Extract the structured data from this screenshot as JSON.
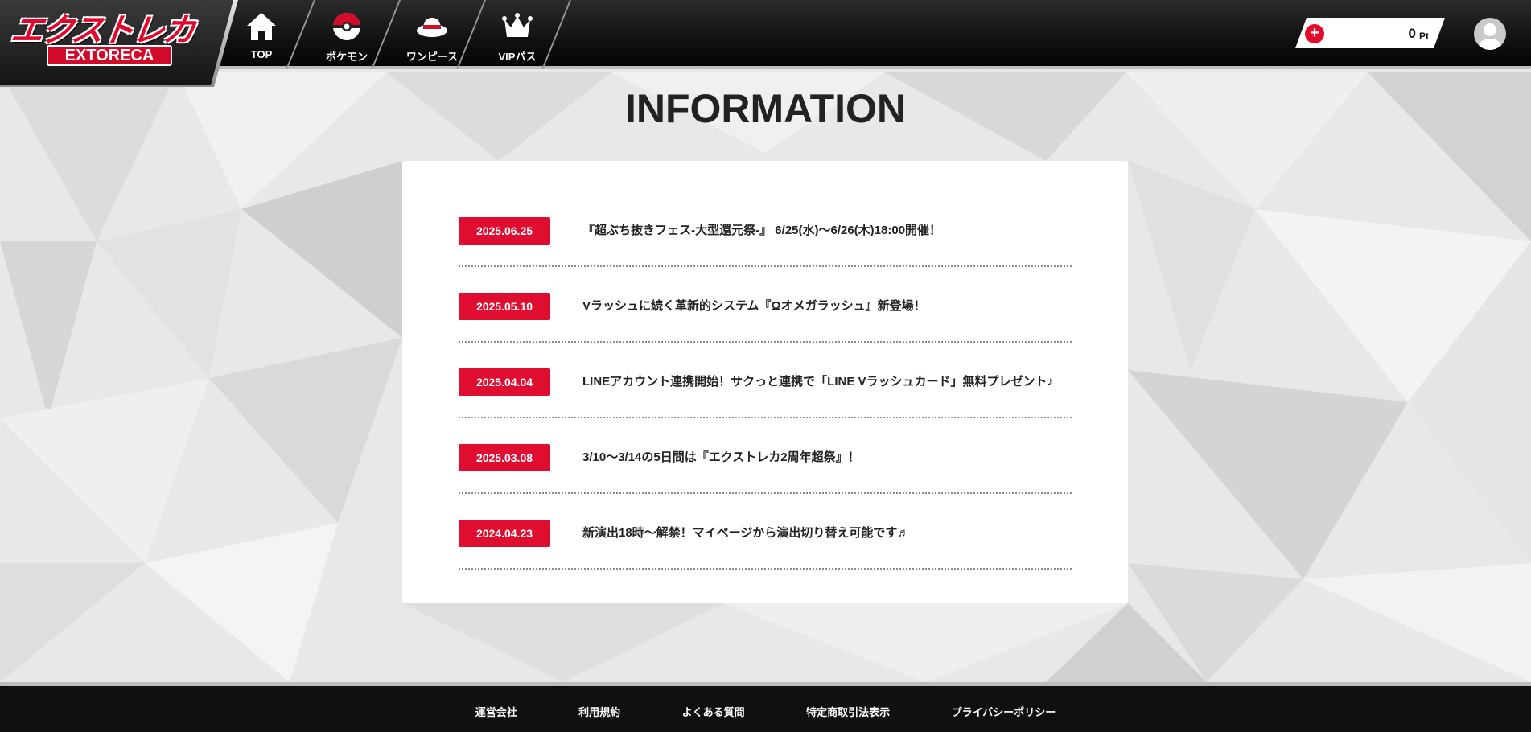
{
  "header": {
    "logo_jp": "エクストレカ",
    "logo_en": "EXTORECA",
    "nav": [
      {
        "label": "TOP",
        "icon": "home-icon"
      },
      {
        "label": "ポケモン",
        "icon": "pokeball-icon"
      },
      {
        "label": "ワンピース",
        "icon": "straw-hat-icon"
      },
      {
        "label": "VIPパス",
        "icon": "crown-icon"
      }
    ],
    "points": {
      "add_icon": "plus-icon",
      "add_symbol": "+",
      "value": "0",
      "unit": "Pt"
    },
    "avatar_icon": "user-avatar-icon"
  },
  "main": {
    "title": "INFORMATION",
    "news": [
      {
        "date": "2025.06.25",
        "title": "『超ぶち抜きフェス-大型還元祭-』 6/25(水)〜6/26(木)18:00開催！"
      },
      {
        "date": "2025.05.10",
        "title": "Vラッシュに続く革新的システム『Ωオメガラッシュ』新登場！"
      },
      {
        "date": "2025.04.04",
        "title": "LINEアカウント連携開始！サクっと連携で「LINE Vラッシュカード」無料プレゼント♪"
      },
      {
        "date": "2025.03.08",
        "title": "3/10〜3/14の5日間は『エクストレカ2周年超祭』！"
      },
      {
        "date": "2024.04.23",
        "title": "新演出18時〜解禁！マイページから演出切り替え可能です♬"
      }
    ]
  },
  "footer": {
    "links": [
      "運営会社",
      "利用規約",
      "よくある質問",
      "特定商取引法表示",
      "プライバシーポリシー"
    ]
  },
  "colors": {
    "accent_red": "#df0d30",
    "header_black": "#111111",
    "page_bg": "#e9e9e9"
  }
}
